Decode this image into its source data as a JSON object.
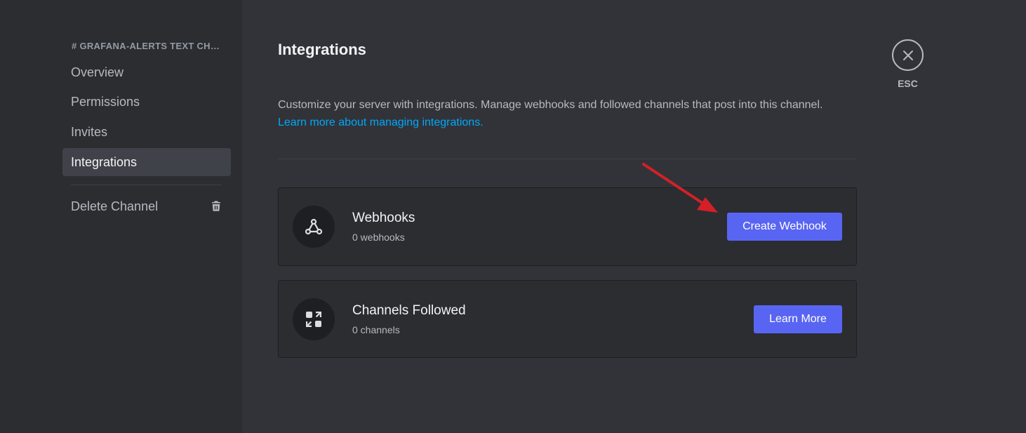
{
  "sidebar": {
    "header": "# GRAFANA-ALERTS TEXT CHANNEL",
    "items": [
      {
        "label": "Overview"
      },
      {
        "label": "Permissions"
      },
      {
        "label": "Invites"
      },
      {
        "label": "Integrations"
      }
    ],
    "delete_label": "Delete Channel"
  },
  "main": {
    "title": "Integrations",
    "description": "Customize your server with integrations. Manage webhooks and followed channels that post into this channel.",
    "learn_link": "Learn more about managing integrations.",
    "webhooks": {
      "title": "Webhooks",
      "count": "0 webhooks",
      "button": "Create Webhook"
    },
    "channels_followed": {
      "title": "Channels Followed",
      "count": "0 channels",
      "button": "Learn More"
    }
  },
  "close": {
    "label": "ESC"
  },
  "colors": {
    "accent": "#5865f2",
    "link": "#00a8fc",
    "annotation_arrow": "#d32027"
  }
}
